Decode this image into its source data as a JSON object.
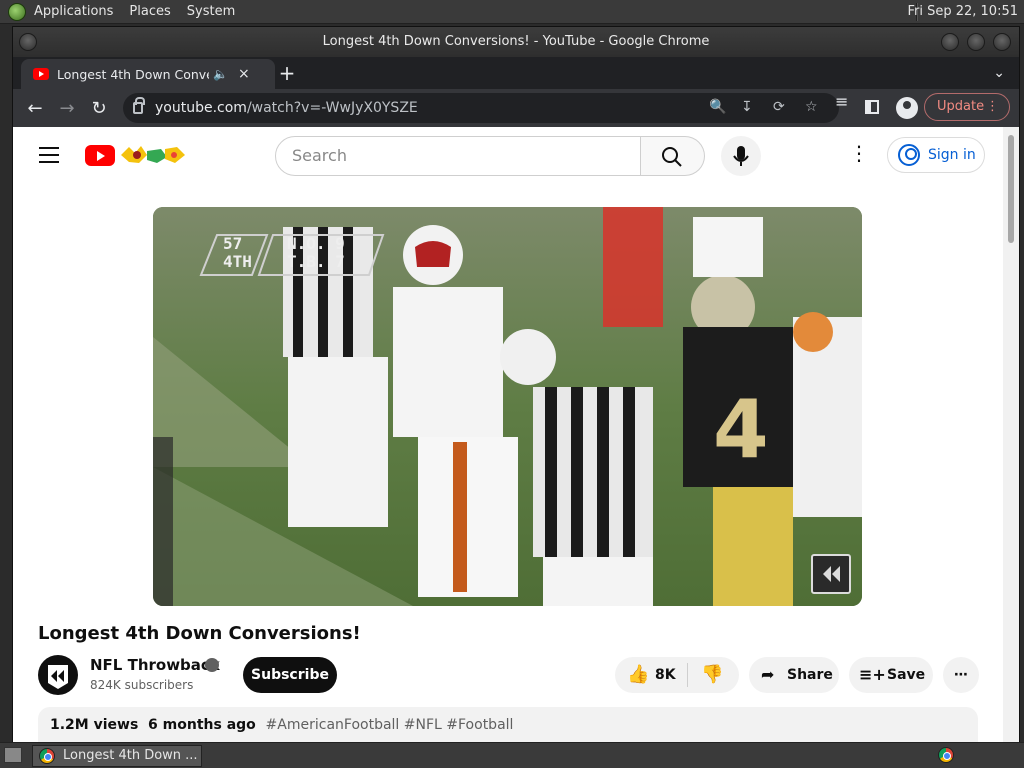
{
  "panel": {
    "menus": [
      "Applications",
      "Places",
      "System"
    ],
    "clock": "Fri Sep 22, 10:51"
  },
  "window": {
    "title": "Longest 4th Down Conversions! - YouTube - Google Chrome"
  },
  "tab": {
    "title": "Longest 4th Down Convers",
    "audio_icon": "speaker-icon",
    "close": "×",
    "new_tab": "+"
  },
  "toolbar": {
    "url_domain": "youtube.com",
    "url_path": "/watch?v=-WwJyX0YSZE",
    "update_label": "Update"
  },
  "youtube": {
    "search_placeholder": "Search",
    "signin_label": "Sign in",
    "video": {
      "scorebug_down": "57\n4TH",
      "scorebug_teams": "N.O. 9\nT.B. 7",
      "title": "Longest 4th Down Conversions!",
      "channel_name": "NFL Throwback",
      "subscribers": "824K subscribers",
      "subscribe_label": "Subscribe",
      "likes": "8K",
      "share_label": "Share",
      "save_label": "Save",
      "views": "1.2M views",
      "age": "6 months ago",
      "tags": "#AmericanFootball #NFL #Football"
    }
  },
  "taskbar": {
    "task_label": "Longest 4th Down ..."
  },
  "colors": {
    "yt_red": "#ff0000",
    "link_blue": "#065fd4",
    "update_red": "#f28b82"
  }
}
